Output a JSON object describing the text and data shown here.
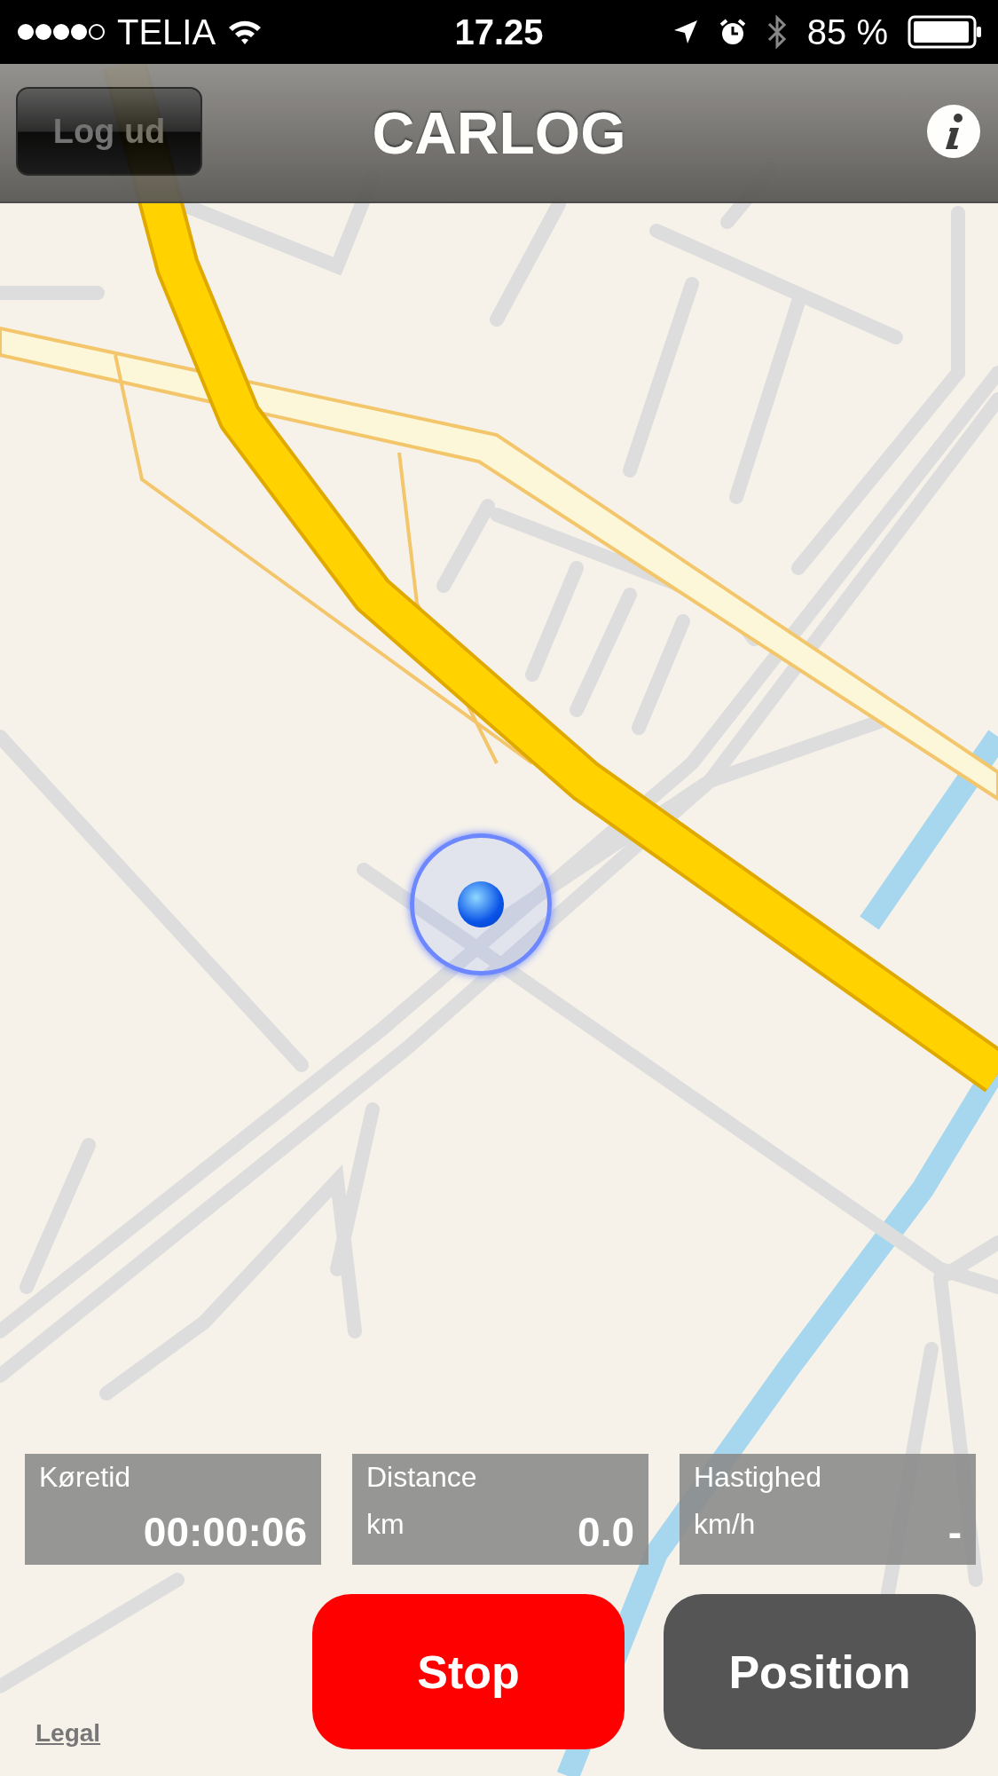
{
  "status_bar": {
    "carrier": "TELIA",
    "time": "17.25",
    "battery": "85 %"
  },
  "nav_bar": {
    "back_button": "Log ud",
    "title": "CARLOG"
  },
  "stats": [
    {
      "label": "Køretid",
      "value": "00:00:06"
    },
    {
      "label": "Distance",
      "unit": "km",
      "value": "0.0"
    },
    {
      "label": "Hastighed",
      "unit": "km/h",
      "value": "-"
    }
  ],
  "buttons": [
    {
      "kind": "stop",
      "label": "Stop"
    },
    {
      "kind": "position",
      "label": "Position"
    }
  ],
  "map": {
    "legal_link": "Legal"
  }
}
